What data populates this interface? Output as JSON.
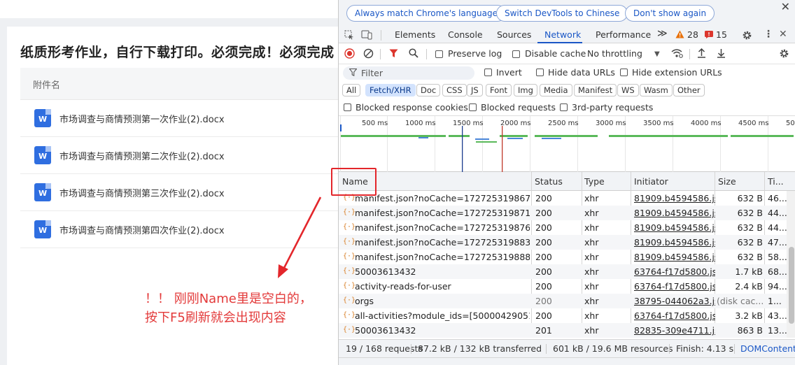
{
  "page": {
    "title": "纸质形考作业，自行下载打印。必须完成！必须完成",
    "column_header": "附件名",
    "files": [
      {
        "name": "市场调查与商情预测第一次作业(2).docx"
      },
      {
        "name": "市场调查与商情预测第二次作业(2).docx"
      },
      {
        "name": "市场调查与商情预测第三次作业(2).docx"
      },
      {
        "name": "市场调查与商情预测第四次作业(2).docx"
      }
    ],
    "file_icon_letter": "W",
    "annotation_lines": [
      "！！ 刚刚Name里是空白的，",
      "按下F5刷新就会出现内容"
    ]
  },
  "devtools": {
    "lang_buttons": [
      "Always match Chrome's language",
      "Switch DevTools to Chinese",
      "Don't show again"
    ],
    "close_glyph": "✕",
    "tabs": [
      "Elements",
      "Console",
      "Sources",
      "Network",
      "Performance"
    ],
    "more_tabs_glyph": "≫",
    "warnings_count": "28",
    "errors_count": "15",
    "toolbar": {
      "preserve_log": "Preserve log",
      "disable_cache": "Disable cache",
      "throttling": "No throttling"
    },
    "filter": {
      "placeholder": "Filter",
      "invert": "Invert",
      "hide_data_urls": "Hide data URLs",
      "hide_extension_urls": "Hide extension URLs"
    },
    "type_filters": [
      "All",
      "Fetch/XHR",
      "Doc",
      "CSS",
      "JS",
      "Font",
      "Img",
      "Media",
      "Manifest",
      "WS",
      "Wasm",
      "Other"
    ],
    "selected_type": "Fetch/XHR",
    "block_filters": [
      "Blocked response cookies",
      "Blocked requests",
      "3rd-party requests"
    ],
    "timeline_ticks": [
      "500 ms",
      "1000 ms",
      "1500 ms",
      "2000 ms",
      "2500 ms",
      "3000 ms",
      "3500 ms",
      "4000 ms",
      "4500 ms",
      "50"
    ],
    "columns": {
      "name": "Name",
      "status": "Status",
      "type": "Type",
      "initiator": "Initiator",
      "size": "Size",
      "time": "Ti..."
    },
    "requests": [
      {
        "name": "manifest.json?noCache=1727253198671...",
        "status": "200",
        "type": "xhr",
        "initiator": "81909.b4594586.js:1",
        "size": "632 B",
        "time": "46..."
      },
      {
        "name": "manifest.json?noCache=1727253198719...",
        "status": "200",
        "type": "xhr",
        "initiator": "81909.b4594586.js:1",
        "size": "632 B",
        "time": "44..."
      },
      {
        "name": "manifest.json?noCache=1727253198764...",
        "status": "200",
        "type": "xhr",
        "initiator": "81909.b4594586.js:1",
        "size": "632 B",
        "time": "44..."
      },
      {
        "name": "manifest.json?noCache=1727253198831...",
        "status": "200",
        "type": "xhr",
        "initiator": "81909.b4594586.js:1",
        "size": "632 B",
        "time": "47..."
      },
      {
        "name": "manifest.json?noCache=1727253198884...",
        "status": "200",
        "type": "xhr",
        "initiator": "81909.b4594586.js:1",
        "size": "632 B",
        "time": "58..."
      },
      {
        "name": "50003613432",
        "status": "200",
        "type": "xhr",
        "initiator": "63764-f17d5800.js:1",
        "size": "1.7 kB",
        "time": "68..."
      },
      {
        "name": "activity-reads-for-user",
        "status": "200",
        "type": "xhr",
        "initiator": "63764-f17d5800.js:1",
        "size": "2.4 kB",
        "time": "94..."
      },
      {
        "name": "orgs",
        "status": "200",
        "type": "xhr",
        "initiator": "38795-044062a3.js:1",
        "size": "(disk cac...",
        "time": "1..."
      },
      {
        "name": "all-activities?module_ids=[50000429051]...",
        "status": "200",
        "type": "xhr",
        "initiator": "63764-f17d5800.js:1",
        "size": "3.2 kB",
        "time": "43..."
      },
      {
        "name": "50003613432",
        "status": "201",
        "type": "xhr",
        "initiator": "82835-309e4711.js:1",
        "size": "863 B",
        "time": "13..."
      }
    ],
    "status_bar": {
      "requests": "19 / 168 requests",
      "transferred": "87.2 kB / 132 kB transferred",
      "resources": "601 kB / 19.6 MB resources",
      "finish": "Finish: 4.13 s",
      "dom": "DOMContentL"
    },
    "colors": {
      "accent": "#1a57c6",
      "annotation": "#e33a3a",
      "file_icon": "#2f6ee0"
    }
  }
}
